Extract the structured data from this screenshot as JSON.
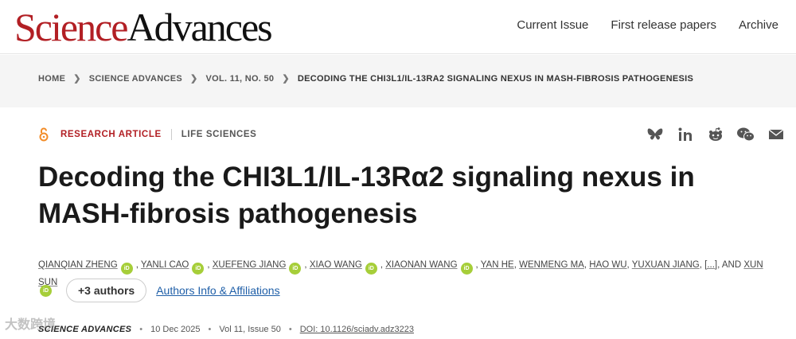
{
  "header": {
    "logo_science": "Science",
    "logo_advances": "Advances",
    "nav": [
      "Current Issue",
      "First release papers",
      "Archive"
    ]
  },
  "breadcrumb": {
    "items": [
      "HOME",
      "SCIENCE ADVANCES",
      "VOL. 11, NO. 50",
      "DECODING THE CHI3L1/IL-13RA2 SIGNALING NEXUS IN MASH-FIBROSIS PATHOGENESIS"
    ]
  },
  "article": {
    "type": "RESEARCH ARTICLE",
    "subject": "LIFE SCIENCES",
    "title": "Decoding the CHI3L1/IL-13Rα2 signaling nexus in MASH-fibrosis pathogenesis",
    "authors": [
      "QIANQIAN ZHENG",
      "YANLI CAO",
      "XUEFENG JIANG",
      "XIAO WANG",
      "XIAONAN WANG",
      "YAN HE",
      "WENMENG MA",
      "HAO WU",
      "YUXUAN JIANG",
      "[...]",
      "XUN SUN"
    ],
    "and_text": ", AND",
    "orcid_label": "iD",
    "more_authors": "+3 authors",
    "info_link": "Authors Info & Affiliations"
  },
  "pub": {
    "journal": "SCIENCE ADVANCES",
    "date": "10 Dec 2025",
    "volume": "Vol 11, Issue 50",
    "doi": "DOI: 10.1126/sciadv.adz3223",
    "dot": "•"
  },
  "share_icons": [
    "bluesky-icon",
    "linkedin-icon",
    "reddit-icon",
    "wechat-icon",
    "email-icon"
  ],
  "colors": {
    "brand_red": "#b21f24",
    "orcid_green": "#a6ce39",
    "link_blue": "#1f5fa8"
  },
  "watermark": "大数跨境"
}
